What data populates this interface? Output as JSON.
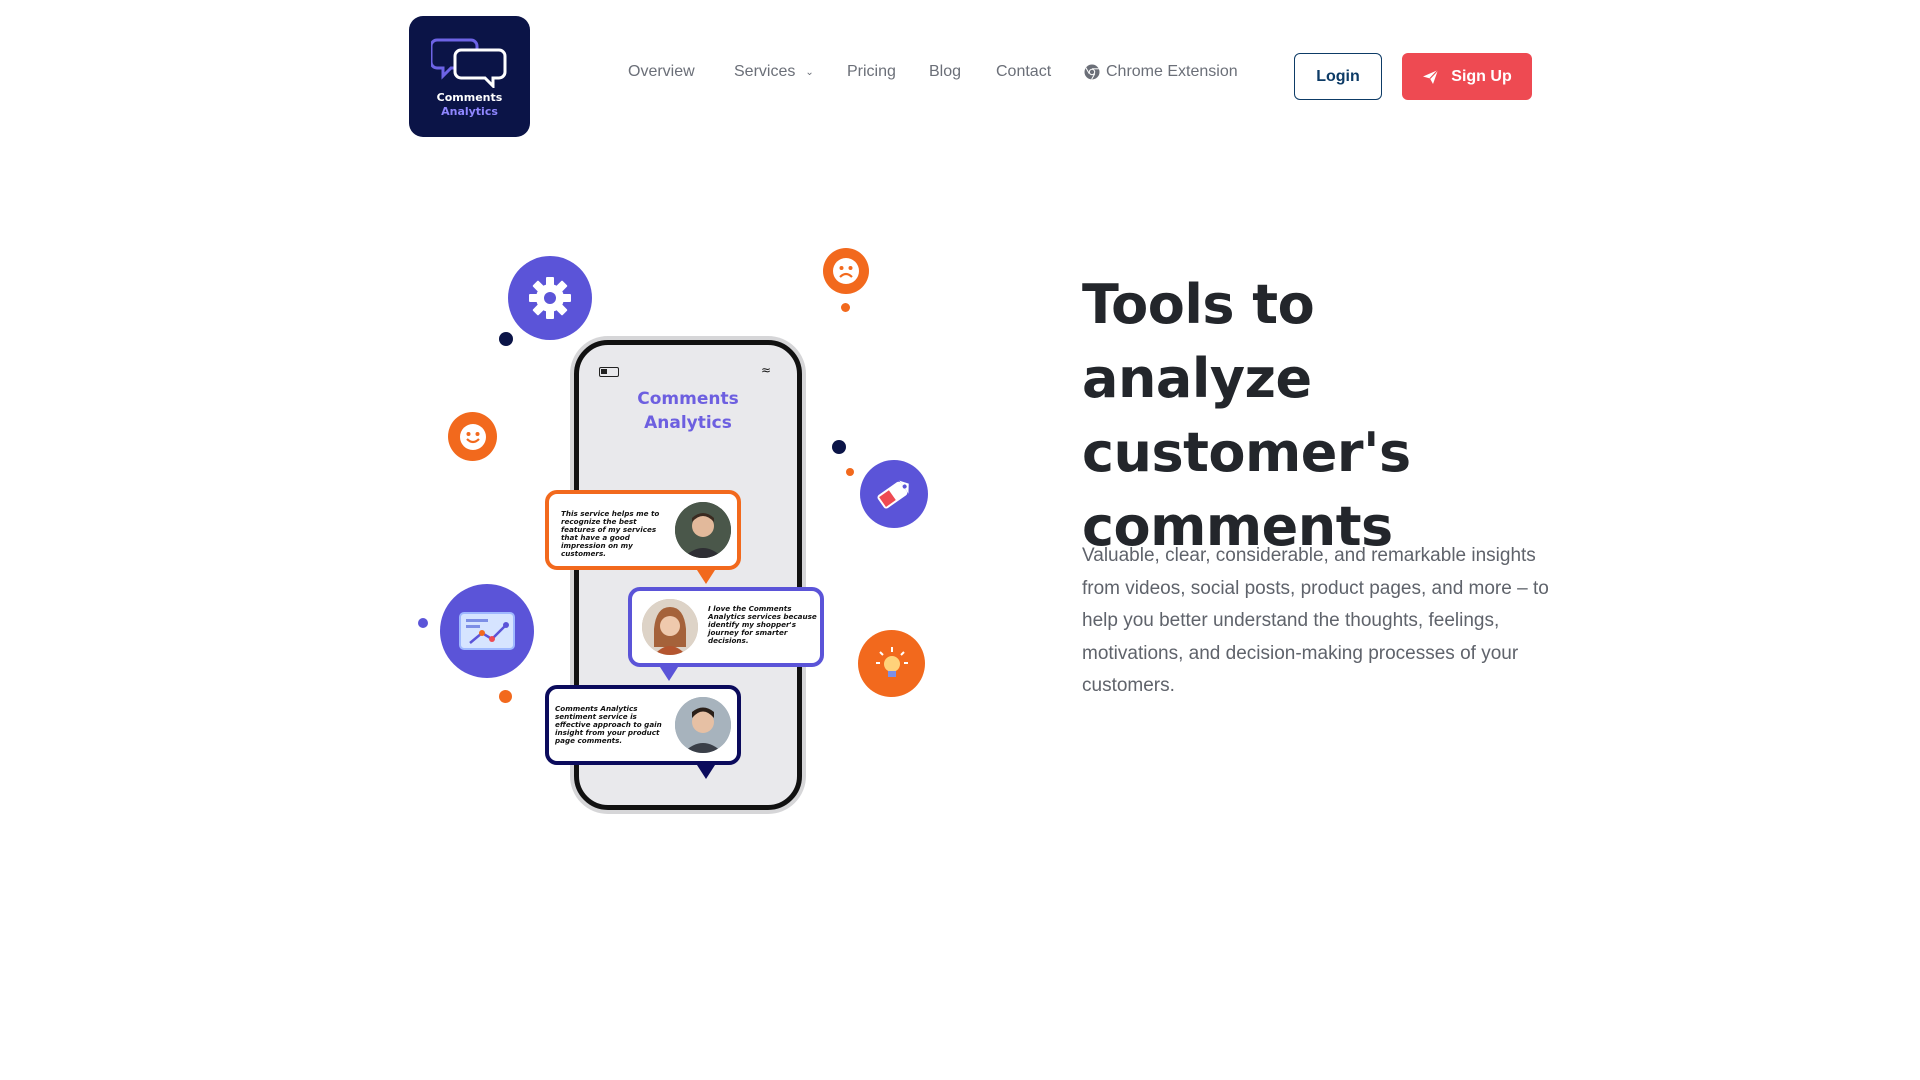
{
  "logo": {
    "line1": "Comments",
    "line2": "Analytics"
  },
  "nav": {
    "items": [
      "Overview",
      "Services",
      "Pricing",
      "Blog",
      "Contact"
    ],
    "chrome_extension": "Chrome Extension"
  },
  "buttons": {
    "login": "Login",
    "signup": "Sign Up"
  },
  "hero": {
    "title": "Tools to analyze customer's comments",
    "description": "Valuable, clear, considerable, and remarkable insights from videos, social posts, product pages, and more – to help you better understand the thoughts, feelings, motivations, and decision-making processes of your customers."
  },
  "illustration": {
    "phone_title_line1": "Comments",
    "phone_title_line2": "Analytics",
    "bubbles": [
      "This service helps me to recognize the best features of my services that have a good impression on my customers.",
      "I love the Comments Analytics services because identify my shopper's journey for smarter decisions.",
      "Comments Analytics sentiment service is effective approach to gain insight from your product page comments."
    ]
  },
  "colors": {
    "brand_navy": "#0b1447",
    "accent_purple": "#5b54d8",
    "accent_orange": "#f2691d",
    "signup_red": "#ee4a52"
  }
}
